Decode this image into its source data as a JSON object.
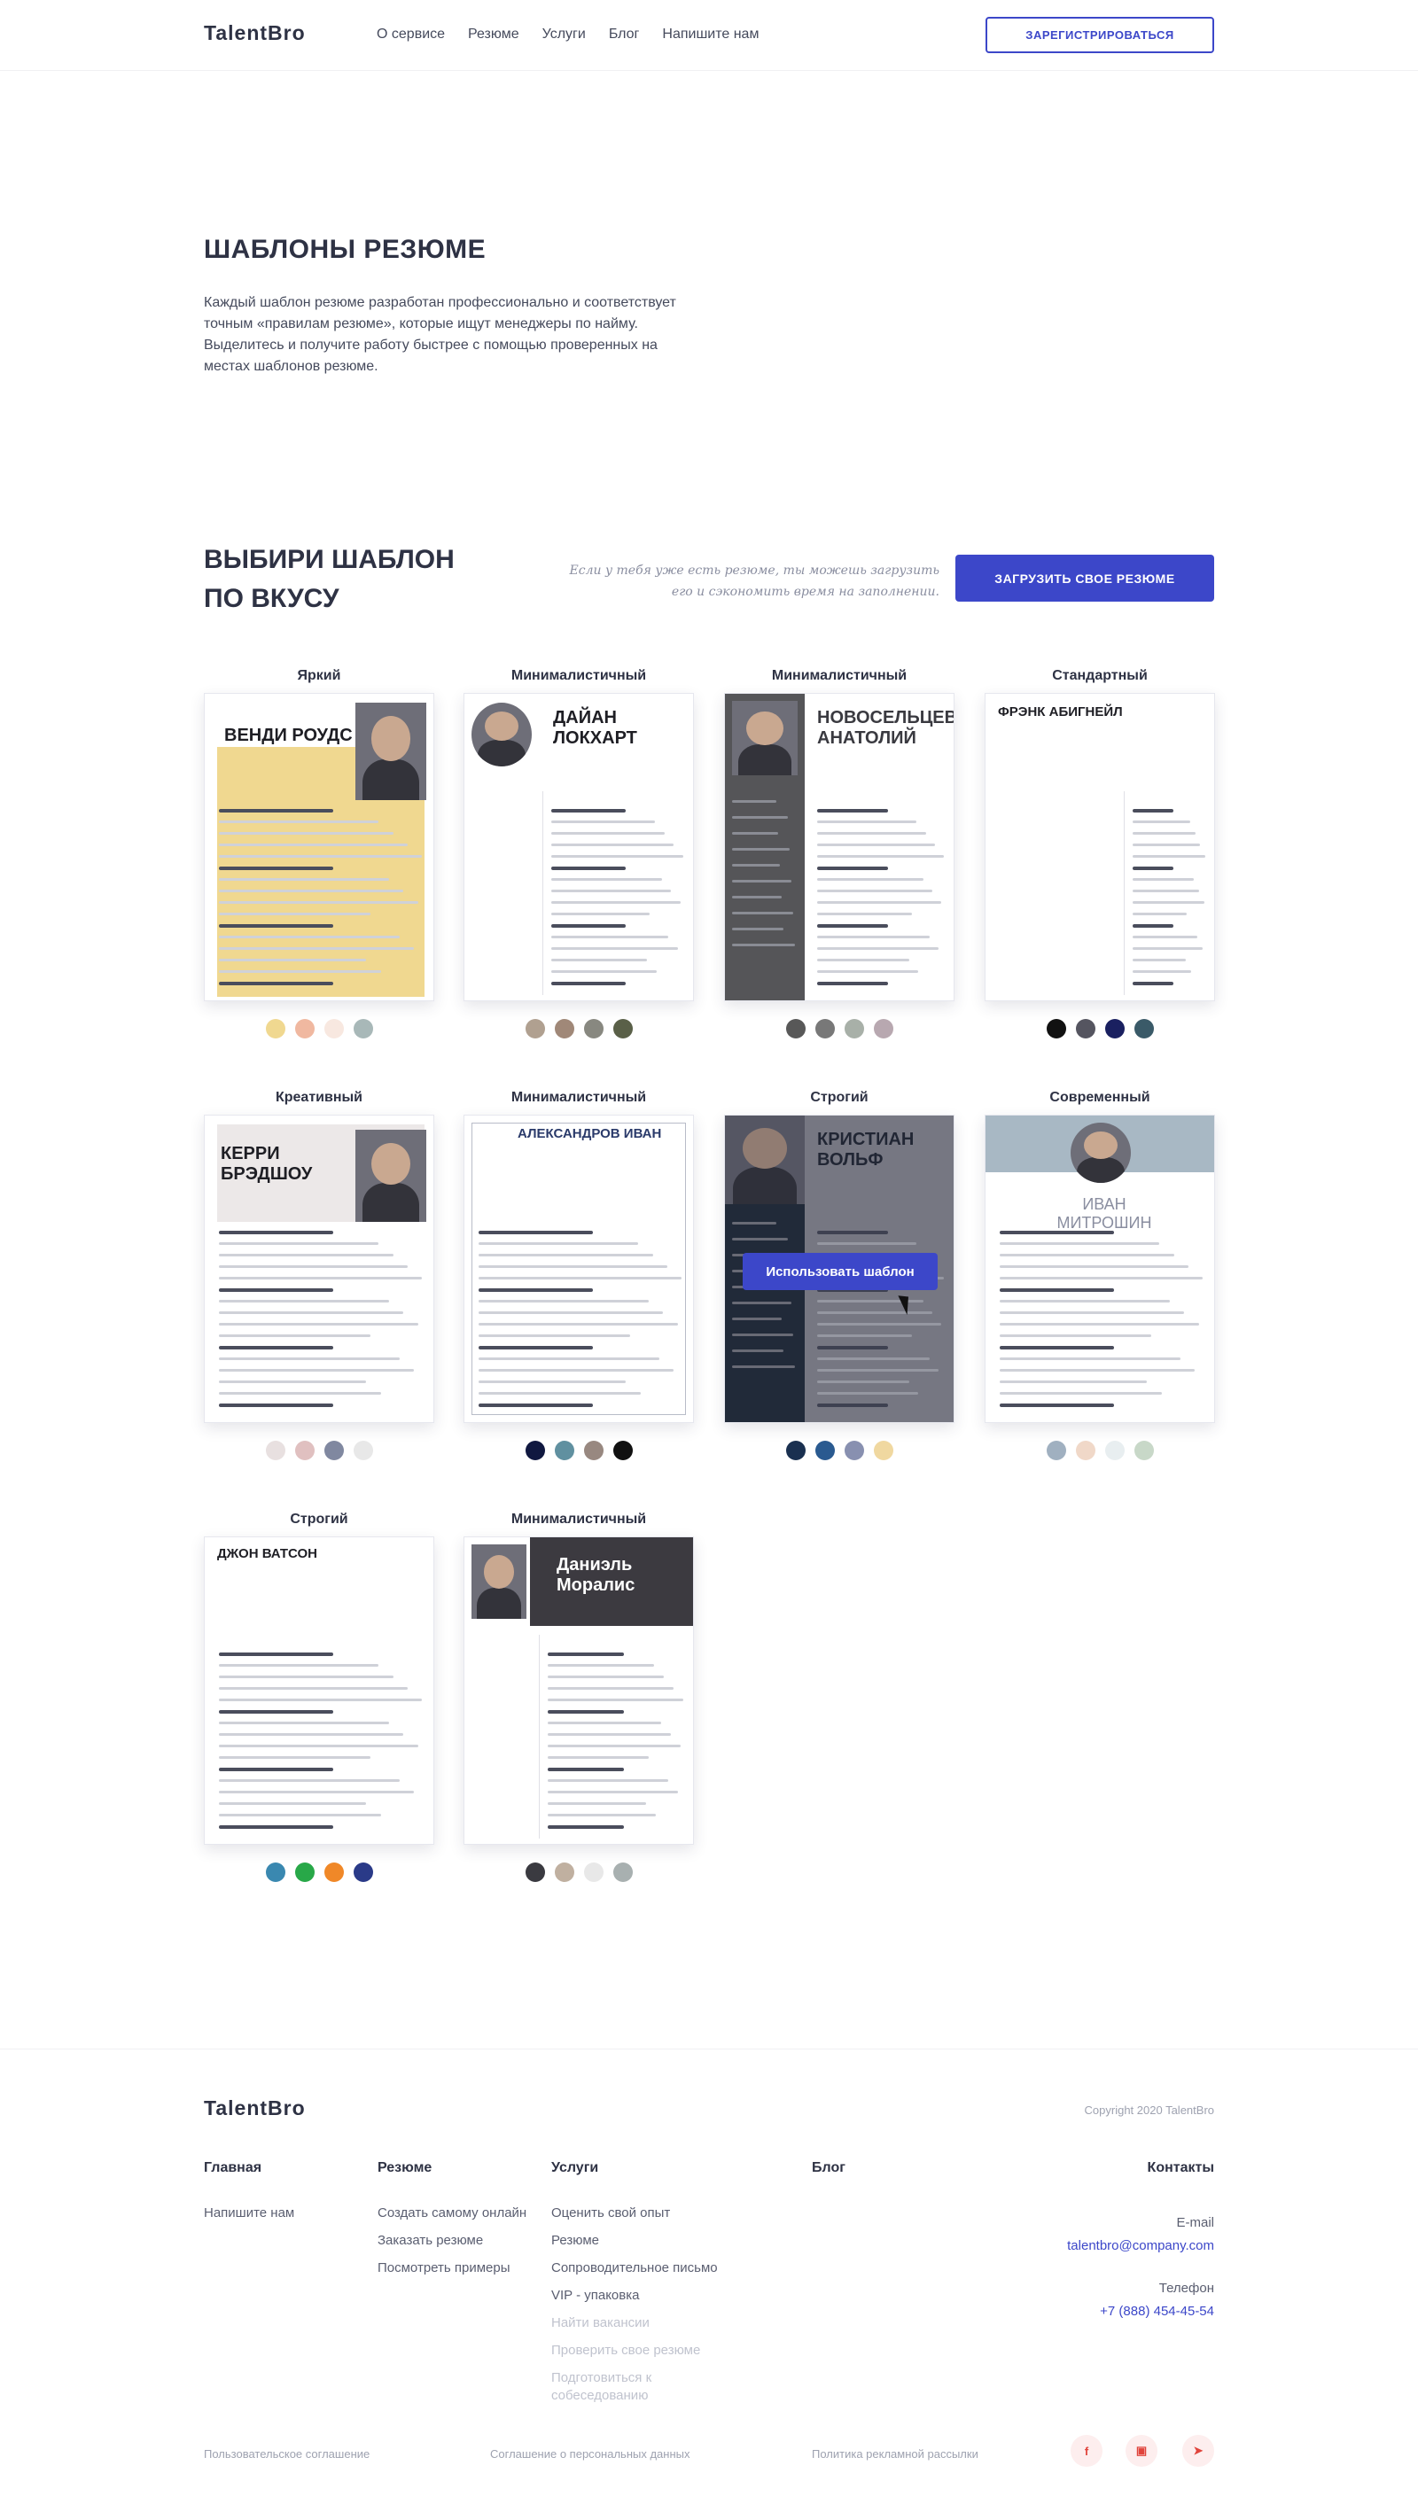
{
  "header": {
    "logo": "TalentBro",
    "nav": [
      "О сервисе",
      "Резюме",
      "Услуги",
      "Блог",
      "Напишите нам"
    ],
    "register": "ЗАРЕГИСТРИРОВАТЬСЯ"
  },
  "hero": {
    "title": "ШАБЛОНЫ РЕЗЮМЕ",
    "text": "Каждый шаблон резюме разработан профессионально и соответствует точным «правилам резюме», которые ищут менеджеры по найму. Выделитесь и получите работу быстрее с помощью проверенных на местах шаблонов резюме."
  },
  "choose": {
    "title": "ВЫБИРИ ШАБЛОН ПО ВКУСУ",
    "hint": "Если у тебя уже есть резюме, ты можешь загрузить его и сэкономить время на заполнении.",
    "upload": "ЗАГРУЗИТЬ СВОЕ РЕЗЮМЕ",
    "use_template": "Использовать шаблон"
  },
  "templates": [
    {
      "title": "Яркий",
      "name": "ВЕНДИ РОУДС",
      "colors": [
        "#f0d890",
        "#f0b8a0",
        "#f8e8e0",
        "#a8b8b8"
      ]
    },
    {
      "title": "Минималистичный",
      "name": "ДАЙАН ЛОКХАРТ",
      "colors": [
        "#b0a090",
        "#a08878",
        "#888880",
        "#5a6048"
      ]
    },
    {
      "title": "Минималистичный",
      "name": "НОВОСЕЛЬЦЕВ АНАТОЛИЙ",
      "colors": [
        "#585858",
        "#787878",
        "#a8b0a8",
        "#b8a8b0"
      ]
    },
    {
      "title": "Стандартный",
      "name": "ФРЭНК АБИГНЕЙЛ",
      "colors": [
        "#111111",
        "#555560",
        "#1a2060",
        "#3a5a68"
      ]
    },
    {
      "title": "Креативный",
      "name": "КЕРРИ БРЭДШОУ",
      "colors": [
        "#e8e0e0",
        "#e0c0c0",
        "#8088a0",
        "#e8e8e8"
      ]
    },
    {
      "title": "Минималистичный",
      "name": "АЛЕКСАНДРОВ ИВАН",
      "colors": [
        "#101840",
        "#6090a0",
        "#988880",
        "#111111"
      ]
    },
    {
      "title": "Строгий",
      "name": "КРИСТИАН ВОЛЬФ",
      "colors": [
        "#1a3050",
        "#2a5a90",
        "#8890b0",
        "#f0d8a0"
      ]
    },
    {
      "title": "Современный",
      "name": "ИВАН МИТРОШИН",
      "colors": [
        "#a0b0c0",
        "#f0d8c8",
        "#e8eef0",
        "#c8d8c8"
      ]
    },
    {
      "title": "Строгий",
      "name": "ДЖОН ВАТСОН",
      "colors": [
        "#3a88b0",
        "#28a848",
        "#f08828",
        "#2a3a88"
      ]
    },
    {
      "title": "Минималистичный",
      "name": "Даниэль Моралис",
      "colors": [
        "#3a3a40",
        "#c0b0a0",
        "#e8e8e8",
        "#a8b0b0"
      ]
    }
  ],
  "footer": {
    "logo": "TalentBro",
    "copyright": "Copyright 2020 TalentBro",
    "col1": {
      "title": "Главная",
      "items": [
        "Напишите нам"
      ]
    },
    "col2": {
      "title": "Резюме",
      "items": [
        "Создать самому онлайн",
        "Заказать резюме",
        "Посмотреть примеры"
      ]
    },
    "col3": {
      "title": "Услуги",
      "items": [
        "Оценить свой опыт",
        "Резюме",
        "Сопроводительное письмо",
        "VIP - упаковка"
      ],
      "muted": [
        "Найти вакансии",
        "Проверить свое резюме",
        "Подготовиться к собеседованию"
      ]
    },
    "col4": {
      "title": "Блог"
    },
    "contacts": {
      "title": "Контакты",
      "email_label": "E-mail",
      "email": "talentbro@company.com",
      "phone_label": "Телефон",
      "phone": "+7 (888) 454-45-54"
    },
    "legal": [
      "Пользовательское соглашение",
      "Соглашение о персональных данных",
      "Политика рекламной рассылки"
    ],
    "social": [
      "facebook-icon",
      "instagram-icon",
      "telegram-icon"
    ]
  }
}
